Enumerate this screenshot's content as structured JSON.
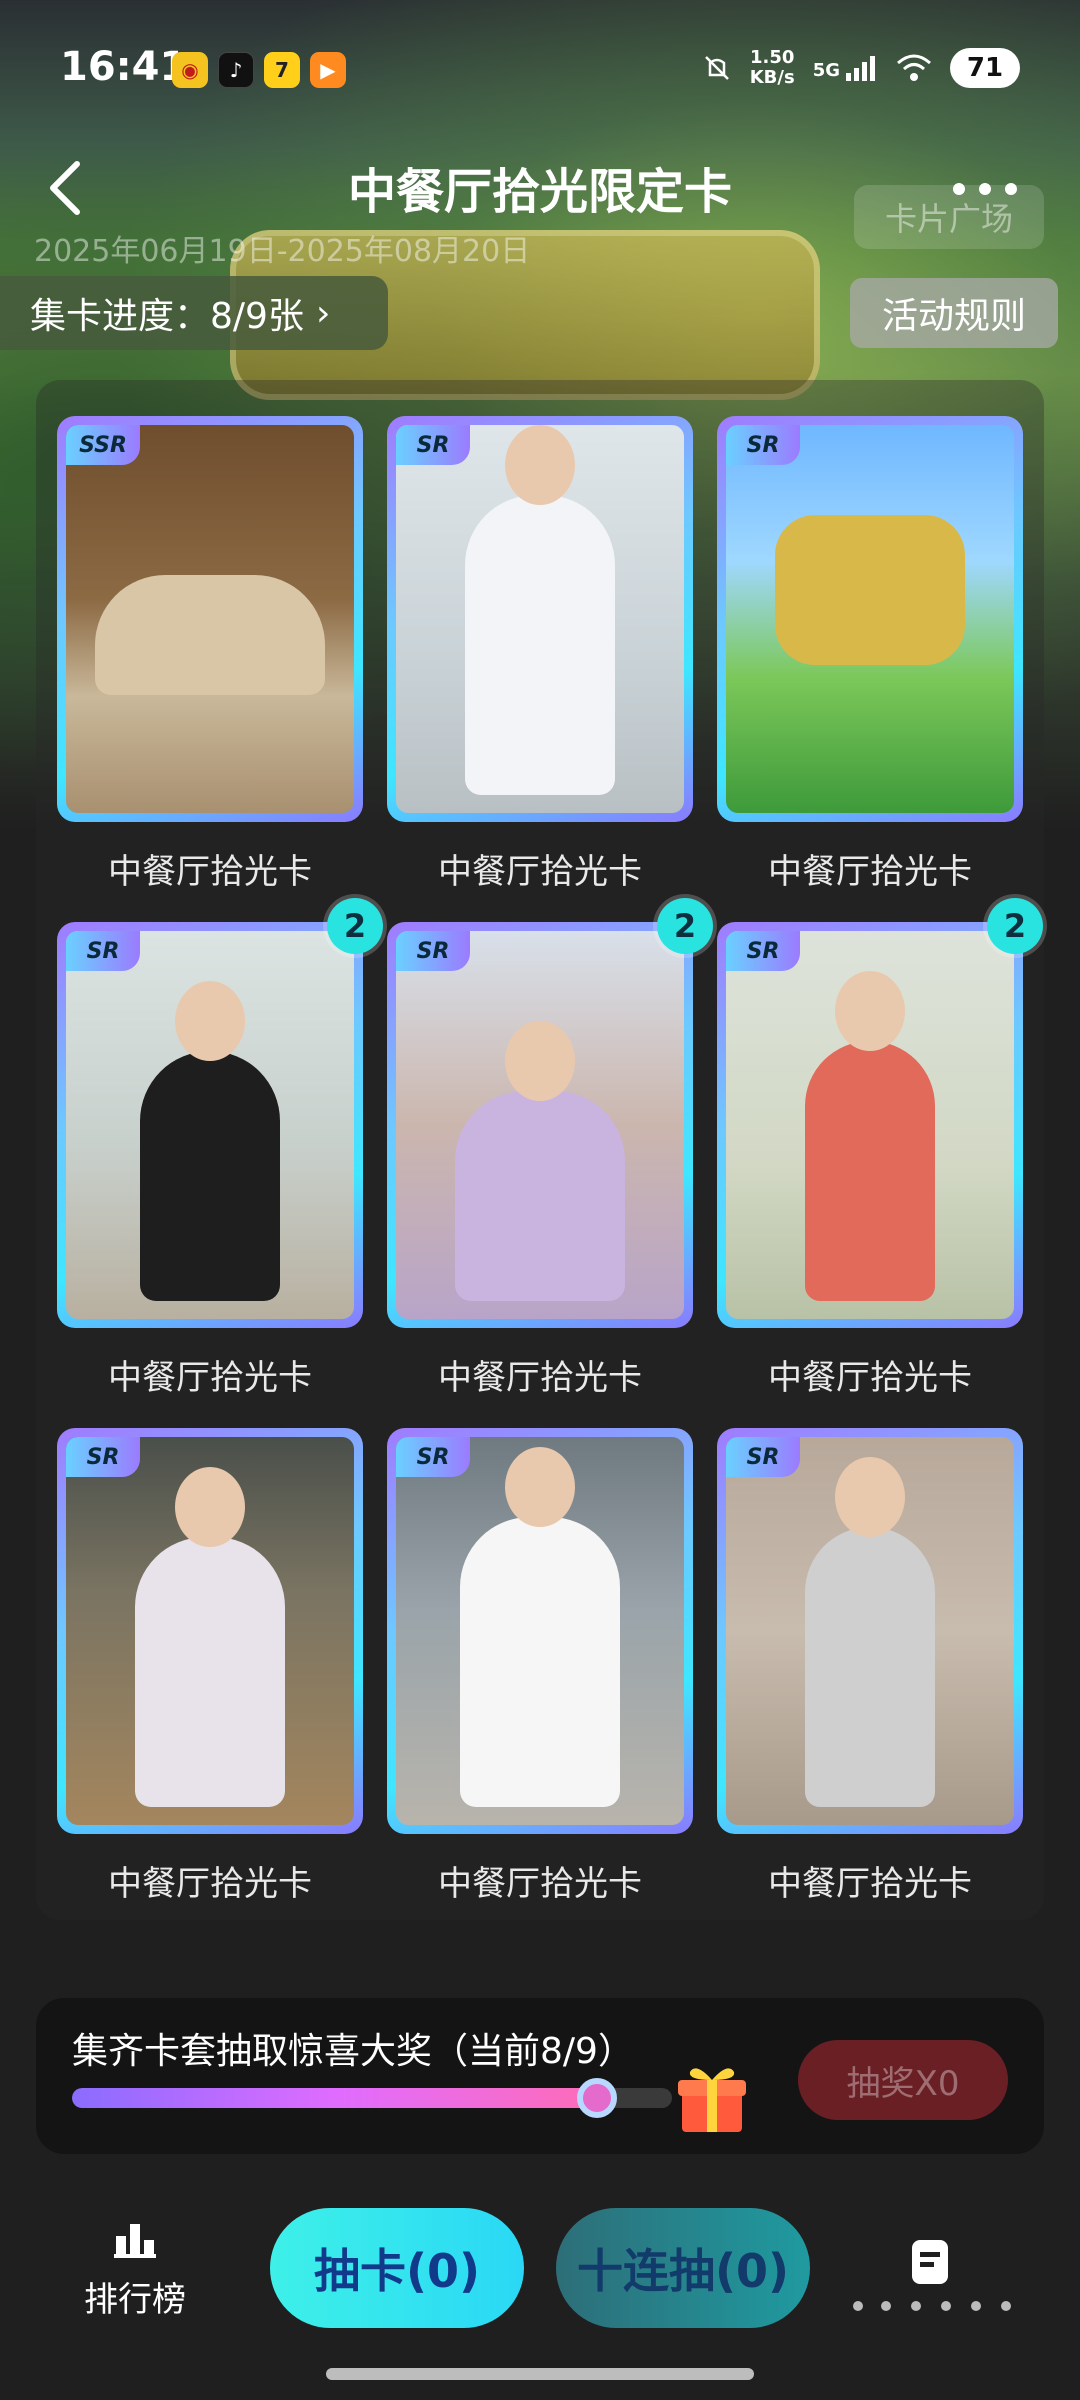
{
  "status_bar": {
    "time": "16:41",
    "net_speed_value": "1.50",
    "net_speed_unit": "KB/s",
    "net_type": "5G",
    "battery": "71",
    "app_icons": [
      "weibo-icon",
      "douyin-icon",
      "qimao-icon",
      "video-app-icon"
    ]
  },
  "nav": {
    "title": "中餐厅拾光限定卡",
    "back_icon": "chevron-left-icon",
    "more_icon": "more-dots-icon"
  },
  "hero": {
    "date_range": "2025年06月19日-2025年08月20日",
    "card_plaza": "卡片广场"
  },
  "progress": {
    "label": "集卡进度：8/9张",
    "chevron": "›"
  },
  "rules_button": "活动规则",
  "cards": [
    {
      "rarity": "SSR",
      "label": "中餐厅拾光卡",
      "count": null,
      "subject": "group-photo"
    },
    {
      "rarity": "SR",
      "label": "中餐厅拾光卡",
      "count": null,
      "subject": "man-heart-gesture"
    },
    {
      "rarity": "SR",
      "label": "中餐厅拾光卡",
      "count": null,
      "subject": "show-logo"
    },
    {
      "rarity": "SR",
      "label": "中餐厅拾光卡",
      "count": "2",
      "subject": "woman-black-top"
    },
    {
      "rarity": "SR",
      "label": "中餐厅拾光卡",
      "count": "2",
      "subject": "woman-short-hair"
    },
    {
      "rarity": "SR",
      "label": "中餐厅拾光卡",
      "count": "2",
      "subject": "woman-floral-dress"
    },
    {
      "rarity": "SR",
      "label": "中餐厅拾光卡",
      "count": null,
      "subject": "girl-headscarf"
    },
    {
      "rarity": "SR",
      "label": "中餐厅拾光卡",
      "count": null,
      "subject": "man-white-shirt"
    },
    {
      "rarity": "SR",
      "label": "中餐厅拾光卡",
      "count": null,
      "subject": "woman-clapping"
    }
  ],
  "lottery": {
    "text": "集齐卡套抽取惊喜大奖（当前8/9）",
    "progress_fraction": 0.889,
    "button": "抽奖X0",
    "gift_icon": "gift-icon"
  },
  "bottom_bar": {
    "rank_label": "排行榜",
    "rank_icon": "bar-chart-icon",
    "draw_one": "抽卡(0)",
    "draw_ten": "十连抽(0)",
    "doc_icon": "document-icon"
  },
  "colors": {
    "card_border_gradient": [
      "#a07bff",
      "#6ec8ff",
      "#3ee6ff"
    ],
    "draw_one_button": "#3ef0e8",
    "draw_ten_button": "#1f9aa0",
    "lottery_button": "#6a1f25",
    "count_badge": "#29e3e0"
  }
}
